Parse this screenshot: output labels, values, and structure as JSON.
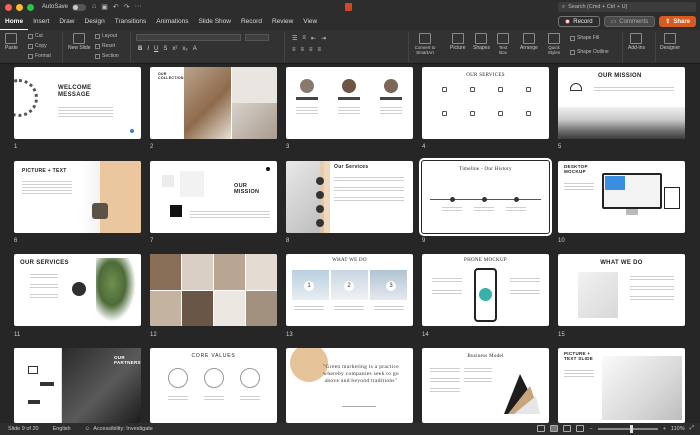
{
  "titlebar": {
    "autosave": "AutoSave",
    "search_placeholder": "Search (Cmd + Ctrl + U)"
  },
  "tabs": [
    "Home",
    "Insert",
    "Draw",
    "Design",
    "Transitions",
    "Animations",
    "Slide Show",
    "Record",
    "Review",
    "View"
  ],
  "toolbar_right": {
    "record": "Record",
    "comments": "Comments",
    "share": "Share"
  },
  "ribbon": {
    "paste": "Paste",
    "cut": "Cut",
    "copy": "Copy",
    "format": "Format",
    "new_slide": "New Slide",
    "layout": "Layout",
    "reset": "Reset",
    "section": "Section",
    "convert": "Convert to SmartArt",
    "picture": "Picture",
    "shapes": "Shapes",
    "text_box": "Text Box",
    "arrange": "Arrange",
    "quick_styles": "Quick Styles",
    "shape_fill": "Shape Fill",
    "shape_outline": "Shape Outline",
    "addins": "Add-ins",
    "designer": "Designer"
  },
  "slides": {
    "s1_title": "WELCOME MESSAGE",
    "s2_title": "OUR COLLECTION",
    "s4_title": "OUR SERVICES",
    "s5_title": "OUR MISSION",
    "s6_title": "PICTURE + TEXT",
    "s7_title": "OUR MISSION",
    "s8_title": "Our Services",
    "s9_title": "Timeline - Our History",
    "s10_title": "DESKTOP MOCKUP",
    "s11_title": "OUR SERVICES",
    "s13_title": "WHAT WE DO",
    "s14_title": "PHONE MOCKUP",
    "s15_title": "WHAT WE DO",
    "s16_title": "OUR PARTNERS",
    "s17_title": "CORE VALUES",
    "s18_quote": "\"Green marketing is a practice whereby companies seek to go above and beyond traditions\"",
    "s19_title": "Business Model",
    "s20_title": "PICTURE + TEXT SLIDE",
    "s13_n1": "1",
    "s13_n2": "2",
    "s13_n3": "3"
  },
  "slide_numbers": [
    "1",
    "2",
    "3",
    "4",
    "5",
    "6",
    "7",
    "8",
    "9",
    "10",
    "11",
    "12",
    "13",
    "14",
    "15"
  ],
  "status": {
    "slide_info": "Slide 9 of 20",
    "language": "English",
    "accessibility": "Accessibility: Investigate",
    "zoom": "110%"
  },
  "colors": {
    "accent": "#d55b20",
    "dark": "#262626",
    "tan": "#e7c39a"
  }
}
